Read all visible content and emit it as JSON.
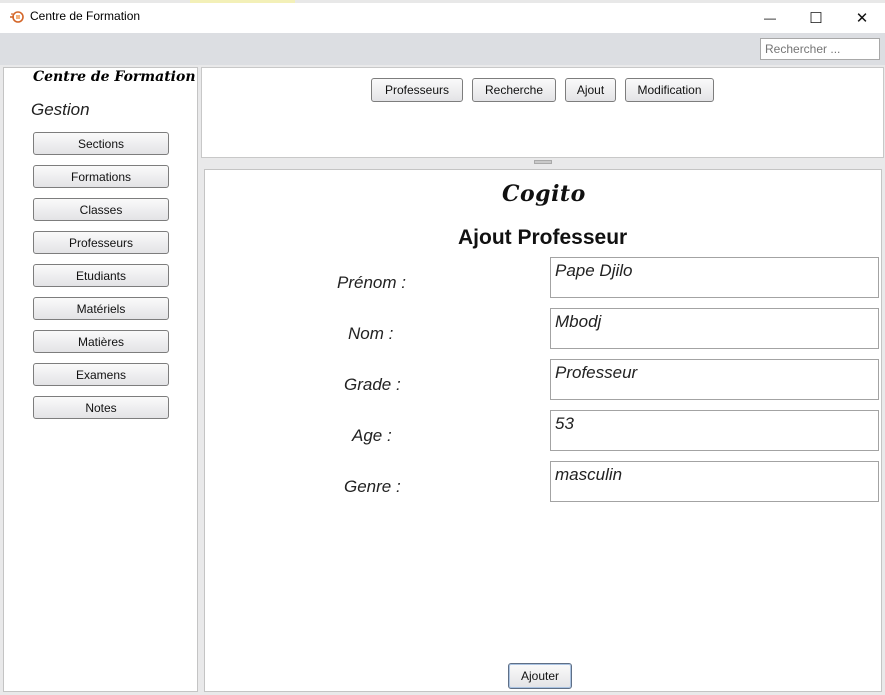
{
  "window": {
    "title": "Centre de Formation",
    "icon": "app-icon",
    "controls": {
      "minimize": "—",
      "maximize": "☐",
      "close": "✕"
    }
  },
  "toolbar": {
    "search": {
      "placeholder": "Rechercher ...",
      "value": ""
    }
  },
  "sidebar": {
    "brand": "Centre de Formation",
    "section_label": "Gestion",
    "items": [
      {
        "label": "Sections"
      },
      {
        "label": "Formations"
      },
      {
        "label": "Classes"
      },
      {
        "label": "Professeurs"
      },
      {
        "label": "Etudiants"
      },
      {
        "label": "Matériels"
      },
      {
        "label": "Matières"
      },
      {
        "label": "Examens"
      },
      {
        "label": "Notes"
      }
    ]
  },
  "tabs": [
    {
      "label": "Professeurs"
    },
    {
      "label": "Recherche"
    },
    {
      "label": "Ajout"
    },
    {
      "label": "Modification"
    }
  ],
  "form": {
    "logo": "Cogito",
    "title": "Ajout Professeur",
    "fields": [
      {
        "label": "Prénom :",
        "value": "Pape Djilo"
      },
      {
        "label": "Nom :",
        "value": "Mbodj"
      },
      {
        "label": "Grade :",
        "value": "Professeur"
      },
      {
        "label": "Age :",
        "value": "53"
      },
      {
        "label": "Genre :",
        "value": "masculin"
      }
    ],
    "submit_label": "Ajouter"
  },
  "colors": {
    "toolbar_bg": "#dcdee2",
    "panel_border": "#c4c4c4",
    "submit_focus": "#aac3e2"
  }
}
